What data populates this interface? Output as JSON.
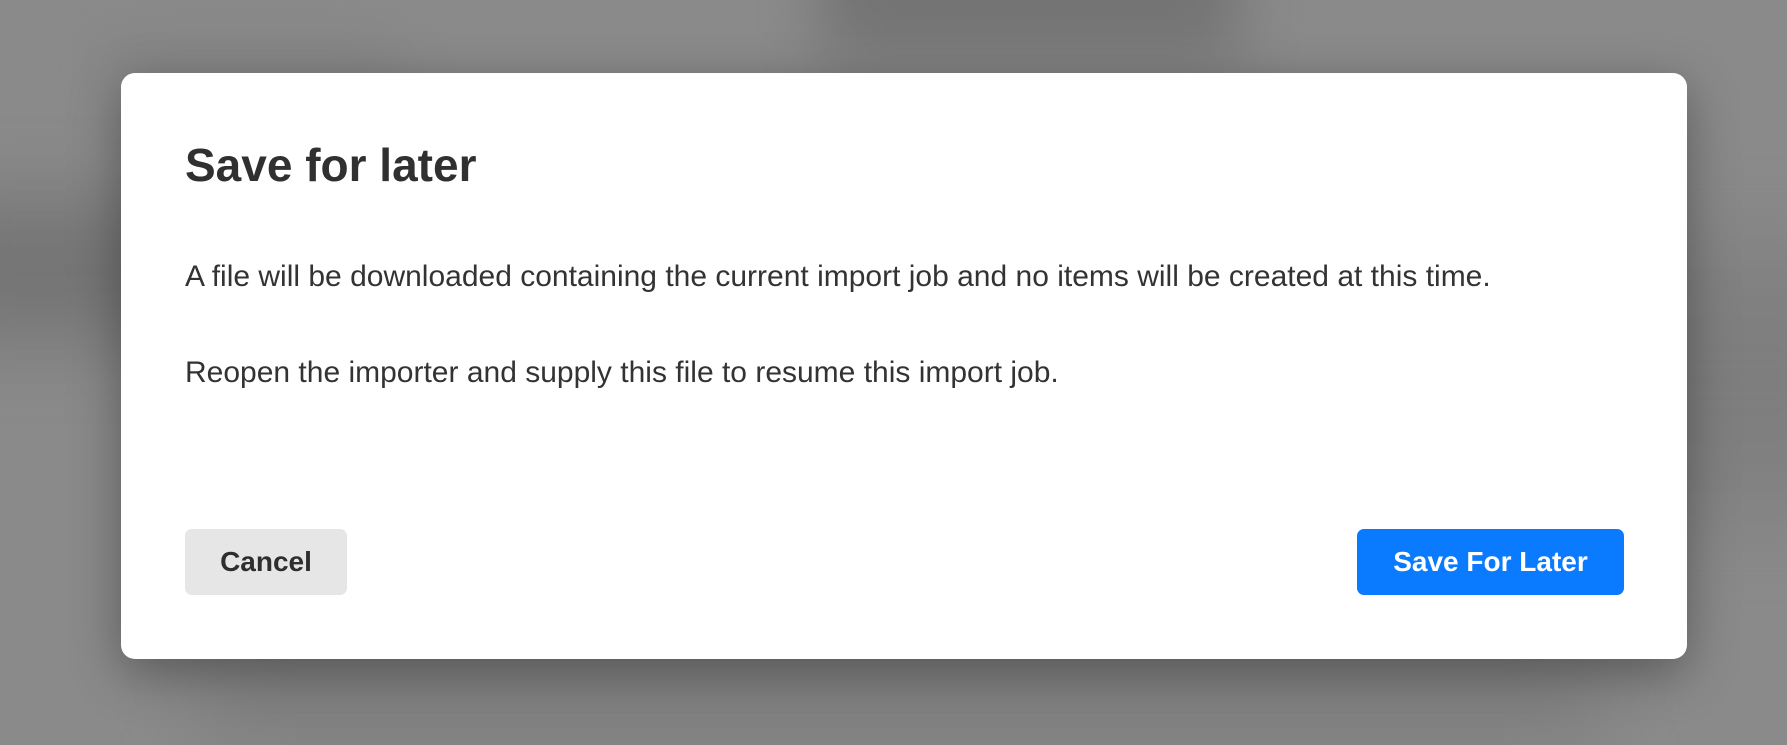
{
  "dialog": {
    "title": "Save for later",
    "body": [
      "A file will be downloaded containing the current import job and no items will be created at this time.",
      "Reopen the importer and supply this file to resume this import job."
    ],
    "cancel_label": "Cancel",
    "confirm_label": "Save For Later"
  },
  "colors": {
    "primary": "#0a7bff",
    "cancel_bg": "#e6e6e6",
    "backdrop": "#8a8a8a"
  }
}
